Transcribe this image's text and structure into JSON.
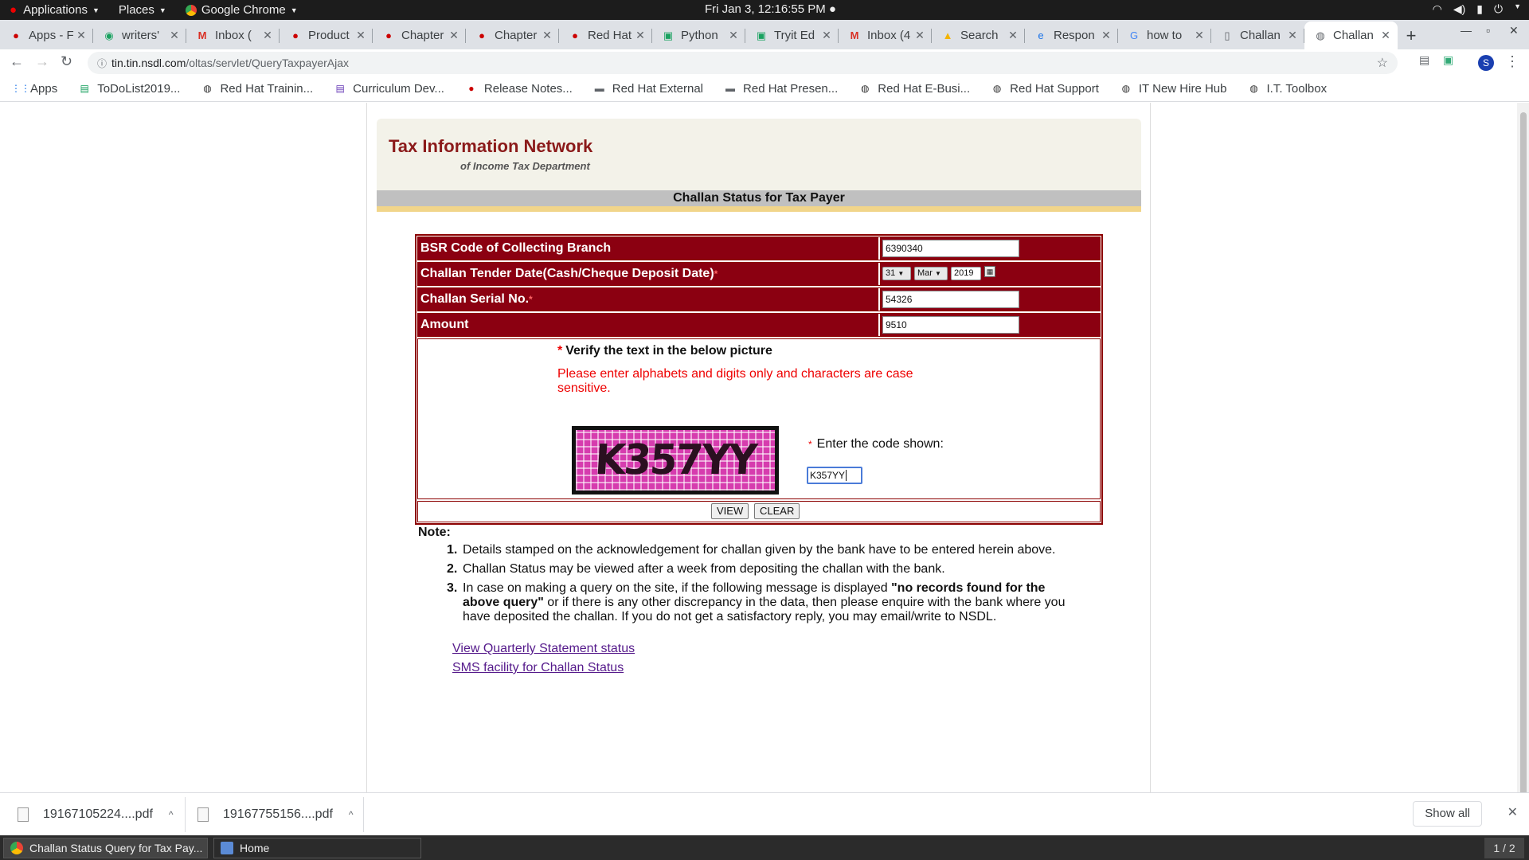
{
  "topbar": {
    "applications": "Applications",
    "places": "Places",
    "browser": "Google Chrome",
    "clock": "Fri Jan  3, 12:16:55 PM"
  },
  "tabs": [
    {
      "title": "Apps - F",
      "icon": "redhat-icon"
    },
    {
      "title": "writers'",
      "icon": "green-circle-icon"
    },
    {
      "title": "Inbox (",
      "icon": "gmail-icon"
    },
    {
      "title": "Product",
      "icon": "redhat-icon"
    },
    {
      "title": "Chapter",
      "icon": "redhat-icon"
    },
    {
      "title": "Chapter",
      "icon": "redhat-icon"
    },
    {
      "title": "Red Hat",
      "icon": "redhat-icon"
    },
    {
      "title": "Python",
      "icon": "green-square-icon"
    },
    {
      "title": "Tryit Ed",
      "icon": "green-square-icon"
    },
    {
      "title": "Inbox (4",
      "icon": "gmail-icon"
    },
    {
      "title": "Search",
      "icon": "drive-icon"
    },
    {
      "title": "Respon",
      "icon": "edge-icon"
    },
    {
      "title": "how to",
      "icon": "google-icon"
    },
    {
      "title": "Challan",
      "icon": "doc-icon"
    },
    {
      "title": "Challan",
      "icon": "globe-icon",
      "active": true
    }
  ],
  "address": {
    "host": "tin.tin.nsdl.com",
    "path": "/oltas/servlet/QueryTaxpayerAjax"
  },
  "profile_initial": "S",
  "bookmarks": [
    {
      "label": "Apps",
      "icon": "apps-grid-icon"
    },
    {
      "label": "ToDoList2019...",
      "icon": "sheets-icon"
    },
    {
      "label": "Red Hat Trainin...",
      "icon": "globe-icon"
    },
    {
      "label": "Curriculum Dev...",
      "icon": "forms-icon"
    },
    {
      "label": "Release Notes...",
      "icon": "redhat-icon"
    },
    {
      "label": "Red Hat External",
      "icon": "folder-icon"
    },
    {
      "label": "Red Hat Presen...",
      "icon": "folder-icon"
    },
    {
      "label": "Red Hat E-Busi...",
      "icon": "globe-icon"
    },
    {
      "label": "Red Hat Support",
      "icon": "globe-icon"
    },
    {
      "label": "IT New Hire Hub",
      "icon": "globe-icon"
    },
    {
      "label": "I.T. Toolbox",
      "icon": "globe-icon"
    }
  ],
  "page": {
    "site_title": "Tax Information Network",
    "site_subtitle": "of Income Tax Department",
    "form_title": "Challan Status for Tax Payer",
    "fields": {
      "bsr_label": "BSR Code of Collecting Branch",
      "bsr_value": "6390340",
      "date_label": "Challan Tender Date(Cash/Cheque Deposit Date)",
      "date_day": "31",
      "date_month": "Mar",
      "date_year": "2019",
      "serial_label": "Challan Serial No.",
      "serial_value": "54326",
      "amount_label": "Amount",
      "amount_value": "9510",
      "required_mark": "*"
    },
    "captcha": {
      "title": "Verify the text in the below picture",
      "note": "Please enter alphabets and digits only and characters are case sensitive.",
      "image_text": "K357YY",
      "code_label": "Enter the code shown:",
      "code_value": "K357YY"
    },
    "buttons": {
      "view": "VIEW",
      "clear": "CLEAR"
    },
    "note_heading": "Note:",
    "notes": [
      {
        "num": "1.",
        "text": "Details stamped on the acknowledgement for challan given by the bank have to be entered herein above."
      },
      {
        "num": "2.",
        "text": "Challan Status may be viewed after a week from depositing the challan with the bank."
      },
      {
        "num": "3.",
        "pre": "In case on making a query on the site, if the following message is displayed ",
        "bold": "\"no records found for the above query\"",
        "post": " or if there is any other discrepancy in the data, then please enquire with the bank where you have deposited the challan. If you do not get a satisfactory reply, you may email/write to NSDL."
      }
    ],
    "links": {
      "quarterly": "View Quarterly Statement status",
      "sms": "SMS facility for Challan Status"
    }
  },
  "downloads": [
    {
      "name": "19167105224....pdf"
    },
    {
      "name": "19167755156....pdf"
    }
  ],
  "shelf": {
    "show_all": "Show all"
  },
  "taskbar": {
    "window1": "Challan Status Query for Tax Pay...",
    "window2": "Home",
    "workspace": "1 / 2"
  }
}
